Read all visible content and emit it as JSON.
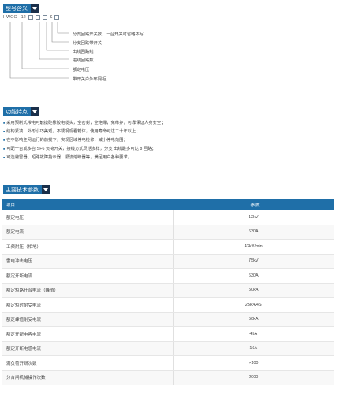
{
  "sections": {
    "model": "型号含义",
    "features": "功能特点",
    "specs": "主要技术参数"
  },
  "model_code": {
    "prefix": "HWGO - 12",
    "suffix": "K"
  },
  "model_labels": [
    "分支回路开关数，一台开关可省略不写",
    "分支回路带开关",
    "出线回路线",
    "进线回路数",
    "额定电压",
    "带开关户外环网柜"
  ],
  "features": [
    "采用预制式带电可触摸硅橡胶电缆头，全密封，全绝缘，免维护，可靠保证人身安全；",
    "结构紧凑，外形小巧美观，不锈钢观看箱体，使用寿命可达二十年以上；",
    "在不影响主网运行的前提下，实现区域停电检修，减小停电范围；",
    "可配一台或多台 SF6 负荷开关，接线方式灵活多样，分支 出线最多可达 8 回路；",
    "可选避雷器、短路故障指示器、限流熔断器等，满足用户各种要求。"
  ],
  "table": {
    "headers": [
      "项目",
      "参数"
    ],
    "rows": [
      [
        "额定电压",
        "12kV"
      ],
      [
        "额定电流",
        "630A"
      ],
      [
        "工频耐压（相地）",
        "42kV/min"
      ],
      [
        "雷电冲击电压",
        "75kV"
      ],
      [
        "额定开断电流",
        "630A"
      ],
      [
        "额定短路开合电流（峰值）",
        "50kA"
      ],
      [
        "额定短时耐受电流",
        "25kA/4S"
      ],
      [
        "额定峰值耐受电流",
        "50kA"
      ],
      [
        "额定开断电容电流",
        "45A"
      ],
      [
        "额定开断电感电流",
        "16A"
      ],
      [
        "满负荷开断次数",
        ">100"
      ],
      [
        "分合闸机械操作次数",
        "2000"
      ]
    ]
  },
  "colors": {
    "accent": "#1f6fa8",
    "arrow_box": "#1a2f4a"
  }
}
